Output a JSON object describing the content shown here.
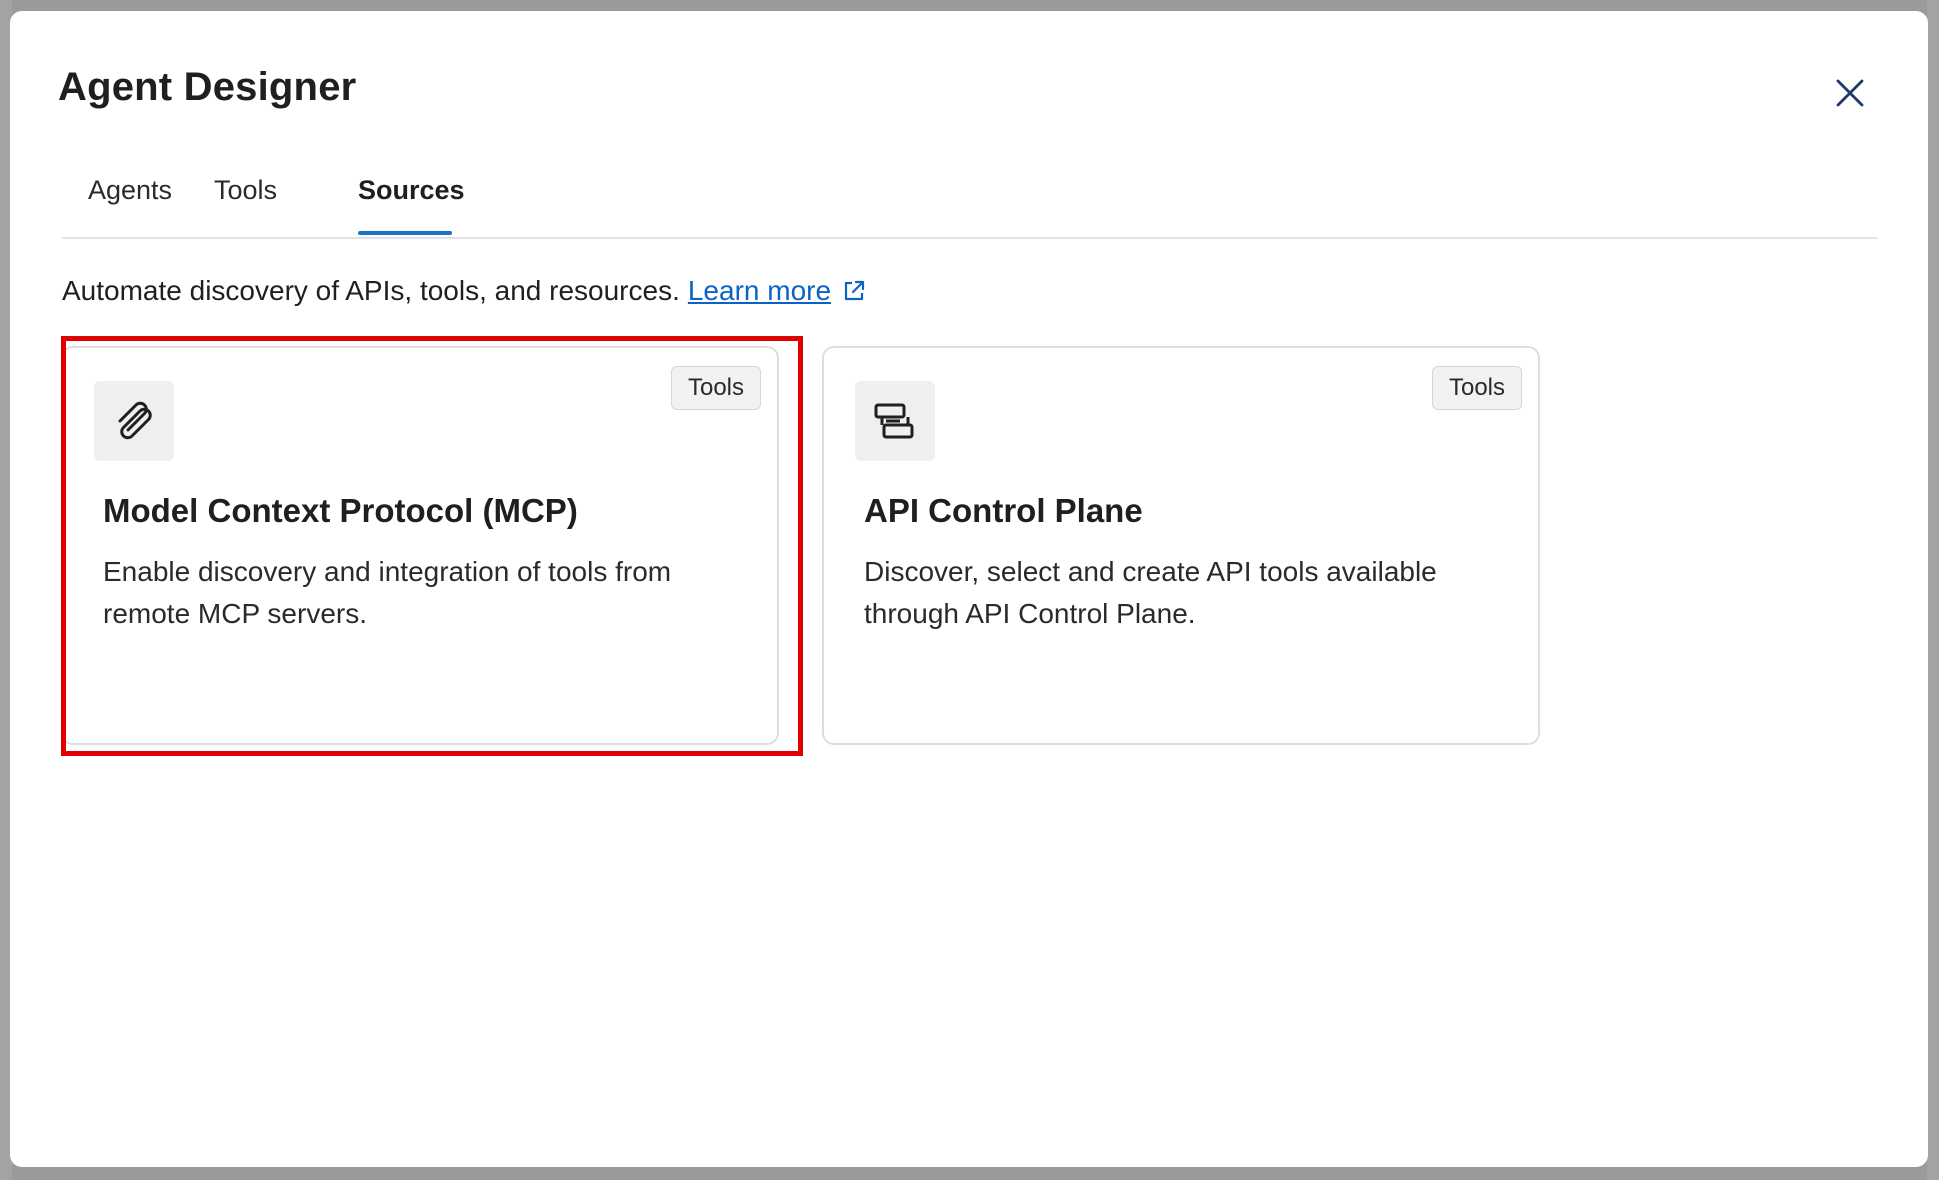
{
  "dialog": {
    "title": "Agent Designer",
    "close_icon": "close-icon"
  },
  "tabs": [
    {
      "label": "Agents",
      "active": false
    },
    {
      "label": "Tools",
      "active": false
    },
    {
      "label": "Sources",
      "active": true
    }
  ],
  "intro": {
    "text": "Automate discovery of APIs, tools, and resources.",
    "link_label": "Learn more",
    "link_icon": "external-link-icon"
  },
  "cards": [
    {
      "icon": "paperclip-icon",
      "badge": "Tools",
      "title": "Model Context Protocol (MCP)",
      "description": "Enable discovery and integration of tools from remote MCP servers.",
      "highlighted": true
    },
    {
      "icon": "api-stack-icon",
      "badge": "Tools",
      "title": "API Control Plane",
      "description": "Discover, select and create API tools available through API Control Plane.",
      "highlighted": false
    }
  ],
  "colors": {
    "accent": "#1a73c8",
    "link": "#0b63c5",
    "highlight": "#e00000"
  }
}
